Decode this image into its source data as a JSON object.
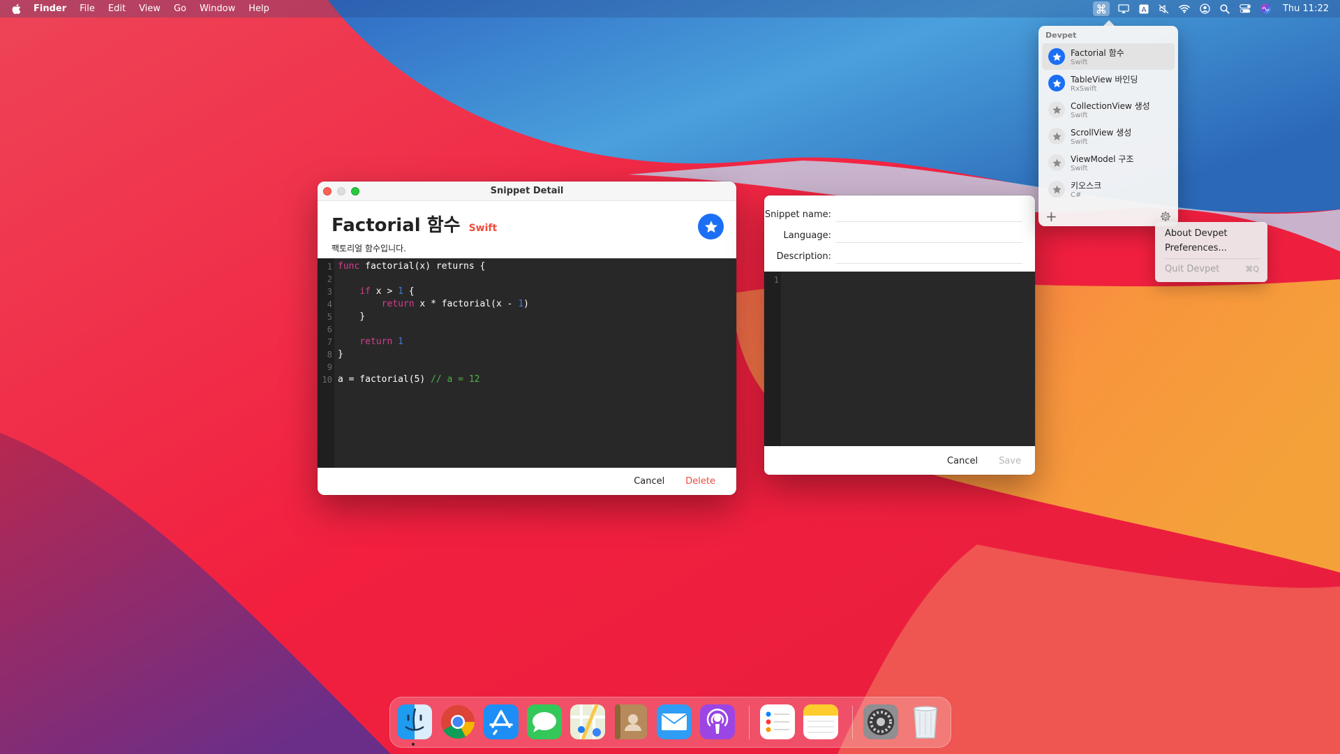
{
  "menubar": {
    "app_name": "Finder",
    "menus": [
      "File",
      "Edit",
      "View",
      "Go",
      "Window",
      "Help"
    ],
    "clock": "Thu 11:22"
  },
  "detail_window": {
    "title": "Snippet Detail",
    "snippet_name": "Factorial 함수",
    "language": "Swift",
    "description": "팩토리얼 함수입니다.",
    "line_numbers": [
      "1",
      "2",
      "3",
      "4",
      "5",
      "6",
      "7",
      "8",
      "9",
      "10"
    ],
    "code": [
      "func factorial(x) returns {",
      "",
      "    if x > 1 {",
      "        return x * factorial(x - 1)",
      "    }",
      "",
      "    return 1",
      "}",
      "",
      "a = factorial(5) // a = 12"
    ],
    "cancel_label": "Cancel",
    "delete_label": "Delete"
  },
  "new_window": {
    "name_label": "Snippet name:",
    "language_label": "Language:",
    "description_label": "Description:",
    "name_value": "",
    "language_value": "",
    "description_value": "",
    "line_numbers": [
      "1"
    ],
    "cancel_label": "Cancel",
    "save_label": "Save"
  },
  "popover": {
    "title": "Devpet",
    "items": [
      {
        "name": "Factorial 함수",
        "language": "Swift",
        "favorite": true,
        "selected": true
      },
      {
        "name": "TableView 바인딩",
        "language": "RxSwift",
        "favorite": true,
        "selected": false
      },
      {
        "name": "CollectionView 생성",
        "language": "Swift",
        "favorite": false,
        "selected": false
      },
      {
        "name": "ScrollView 생성",
        "language": "Swift",
        "favorite": false,
        "selected": false
      },
      {
        "name": "ViewModel 구조",
        "language": "Swift",
        "favorite": false,
        "selected": false
      },
      {
        "name": "키오스크",
        "language": "C#",
        "favorite": false,
        "selected": false
      }
    ],
    "add_label": "+"
  },
  "context_menu": {
    "about_label": "About Devpet",
    "preferences_label": "Preferences...",
    "quit_label": "Quit Devpet",
    "quit_shortcut": "⌘Q"
  },
  "dock": {
    "apps": [
      "finder-icon",
      "chrome-icon",
      "app-store-icon",
      "messages-icon",
      "maps-icon",
      "contacts-icon",
      "mail-icon",
      "podcasts-icon",
      "reminders-icon",
      "notes-icon",
      "system-preferences-icon",
      "trash-icon"
    ]
  },
  "colors": {
    "accent_blue": "#1b6ff5",
    "destructive_red": "#ef4b3c",
    "editor_bg": "#292829",
    "keyword": "#d43e8f",
    "number": "#3d7bd6",
    "comment": "#4fb04b"
  }
}
